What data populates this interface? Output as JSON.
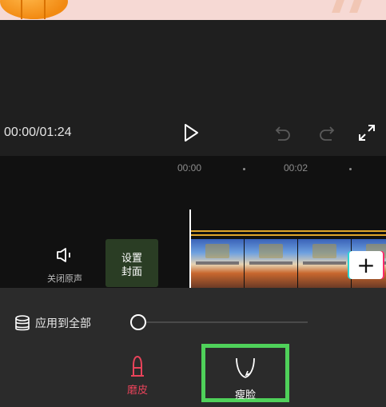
{
  "player": {
    "timecode": "00:00/01:24",
    "icons": {
      "play": "play-icon",
      "undo": "undo-icon",
      "redo": "redo-icon",
      "fullscreen": "fullscreen-icon"
    }
  },
  "timeline": {
    "ticks": [
      "00:00",
      "00:02"
    ],
    "mute_label": "关闭原声",
    "cover_label_line1": "设置",
    "cover_label_line2": "封面",
    "add_clip_label": "+"
  },
  "beauty_panel": {
    "apply_all_label": "应用到全部",
    "intensity_fraction": 0,
    "tools": [
      {
        "label": "磨皮",
        "icon": "face-smooth-icon",
        "color": "#e8435a"
      },
      {
        "label": "瘦脸",
        "icon": "face-slim-icon",
        "color": "#ffffff",
        "selected": true
      }
    ],
    "selection_color": "#4fd15a"
  }
}
